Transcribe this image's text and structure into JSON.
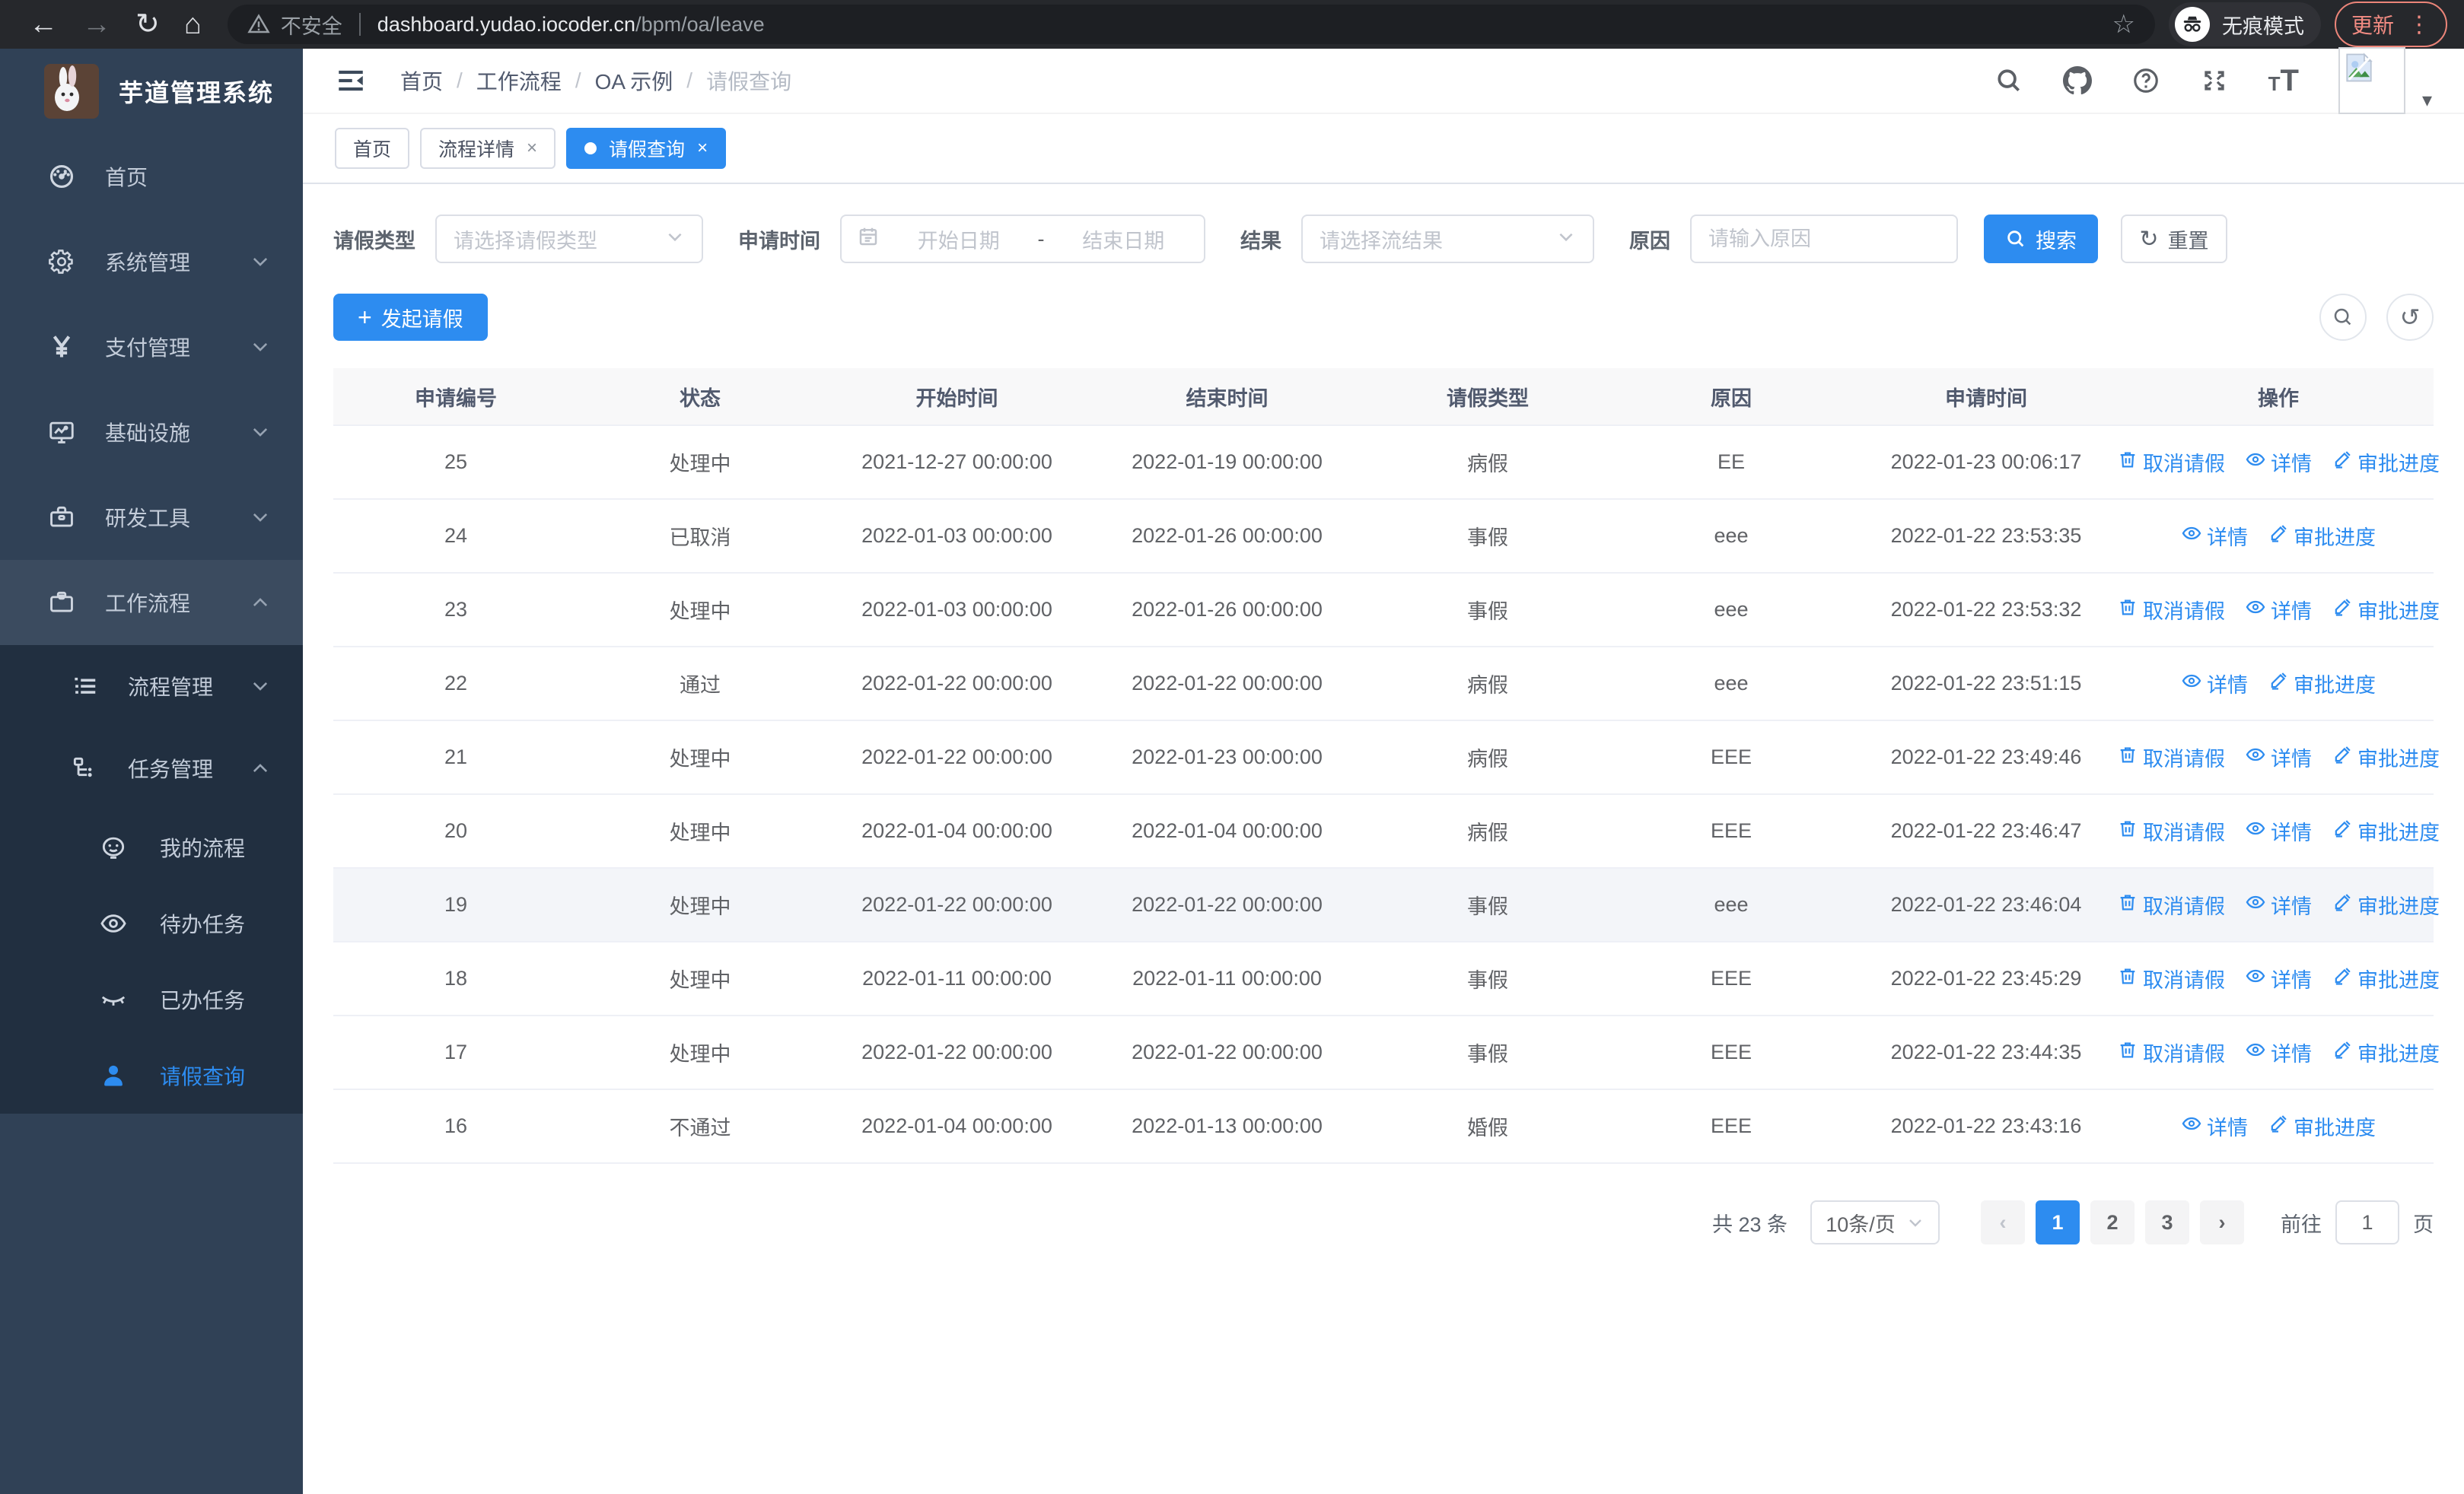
{
  "browser": {
    "security_label": "不安全",
    "url_host": "dashboard.yudao.iocoder.cn",
    "url_path": "/bpm/oa/leave",
    "incognito_label": "无痕模式",
    "update_label": "更新"
  },
  "colors": {
    "primary_blue": "#2d8cf0",
    "sidebar_bg": "#304156",
    "submenu_bg": "#212f40",
    "table_header_bg": "#f8f8f9",
    "highlight_row_bg": "#f3f5f9",
    "update_chip_red": "#f28b82"
  },
  "sidebar": {
    "title": "芋道管理系统",
    "items": [
      {
        "label": "首页",
        "icon": "dashboard-icon",
        "level": 1,
        "chevron": null,
        "active": false,
        "open": false
      },
      {
        "label": "系统管理",
        "icon": "gear-icon",
        "level": 1,
        "chevron": "down",
        "active": false,
        "open": false
      },
      {
        "label": "支付管理",
        "icon": "yen-icon",
        "level": 1,
        "chevron": "down",
        "active": false,
        "open": false
      },
      {
        "label": "基础设施",
        "icon": "monitor-icon",
        "level": 1,
        "chevron": "down",
        "active": false,
        "open": false
      },
      {
        "label": "研发工具",
        "icon": "toolbox-icon",
        "level": 1,
        "chevron": "down",
        "active": false,
        "open": false
      },
      {
        "label": "工作流程",
        "icon": "briefcase-icon",
        "level": 1,
        "chevron": "up",
        "active": false,
        "open": true
      },
      {
        "label": "流程管理",
        "icon": "list-icon",
        "level": 2,
        "chevron": "down",
        "active": false,
        "open": false
      },
      {
        "label": "任务管理",
        "icon": "flow-icon",
        "level": 2,
        "chevron": "up",
        "active": false,
        "open": true
      },
      {
        "label": "我的流程",
        "icon": "face-icon",
        "level": 3,
        "chevron": null,
        "active": false,
        "open": false
      },
      {
        "label": "待办任务",
        "icon": "eye-icon",
        "level": 3,
        "chevron": null,
        "active": false,
        "open": false
      },
      {
        "label": "已办任务",
        "icon": "eye-closed-icon",
        "level": 3,
        "chevron": null,
        "active": false,
        "open": false
      },
      {
        "label": "请假查询",
        "icon": "user-icon",
        "level": 3,
        "chevron": null,
        "active": true,
        "open": false
      }
    ]
  },
  "header": {
    "breadcrumb": [
      "首页",
      "工作流程",
      "OA 示例",
      "请假查询"
    ]
  },
  "tabs": [
    {
      "label": "首页",
      "closable": false,
      "active": false,
      "dot": false
    },
    {
      "label": "流程详情",
      "closable": true,
      "active": false,
      "dot": false
    },
    {
      "label": "请假查询",
      "closable": true,
      "active": true,
      "dot": true
    }
  ],
  "filters": {
    "leave_type_label": "请假类型",
    "leave_type_placeholder": "请选择请假类型",
    "apply_time_label": "申请时间",
    "start_date_placeholder": "开始日期",
    "date_separator": "-",
    "end_date_placeholder": "结束日期",
    "result_label": "结果",
    "result_placeholder": "请选择流结果",
    "reason_label": "原因",
    "reason_placeholder": "请输入原因",
    "search_button": "搜索",
    "reset_button": "重置"
  },
  "toolbar": {
    "create_button": "发起请假"
  },
  "table": {
    "columns": [
      "申请编号",
      "状态",
      "开始时间",
      "结束时间",
      "请假类型",
      "原因",
      "申请时间",
      "操作"
    ],
    "action_labels": {
      "cancel": "取消请假",
      "detail": "详情",
      "progress": "审批进度"
    },
    "rows": [
      {
        "id": "25",
        "status": "处理中",
        "start": "2021-12-27 00:00:00",
        "end": "2022-01-19 00:00:00",
        "type": "病假",
        "reason": "EE",
        "apply_time": "2022-01-23 00:06:17",
        "actions": [
          "cancel",
          "detail",
          "progress"
        ],
        "highlight": false
      },
      {
        "id": "24",
        "status": "已取消",
        "start": "2022-01-03 00:00:00",
        "end": "2022-01-26 00:00:00",
        "type": "事假",
        "reason": "eee",
        "apply_time": "2022-01-22 23:53:35",
        "actions": [
          "detail",
          "progress"
        ],
        "highlight": false
      },
      {
        "id": "23",
        "status": "处理中",
        "start": "2022-01-03 00:00:00",
        "end": "2022-01-26 00:00:00",
        "type": "事假",
        "reason": "eee",
        "apply_time": "2022-01-22 23:53:32",
        "actions": [
          "cancel",
          "detail",
          "progress"
        ],
        "highlight": false
      },
      {
        "id": "22",
        "status": "通过",
        "start": "2022-01-22 00:00:00",
        "end": "2022-01-22 00:00:00",
        "type": "病假",
        "reason": "eee",
        "apply_time": "2022-01-22 23:51:15",
        "actions": [
          "detail",
          "progress"
        ],
        "highlight": false
      },
      {
        "id": "21",
        "status": "处理中",
        "start": "2022-01-22 00:00:00",
        "end": "2022-01-23 00:00:00",
        "type": "病假",
        "reason": "EEE",
        "apply_time": "2022-01-22 23:49:46",
        "actions": [
          "cancel",
          "detail",
          "progress"
        ],
        "highlight": false
      },
      {
        "id": "20",
        "status": "处理中",
        "start": "2022-01-04 00:00:00",
        "end": "2022-01-04 00:00:00",
        "type": "病假",
        "reason": "EEE",
        "apply_time": "2022-01-22 23:46:47",
        "actions": [
          "cancel",
          "detail",
          "progress"
        ],
        "highlight": false
      },
      {
        "id": "19",
        "status": "处理中",
        "start": "2022-01-22 00:00:00",
        "end": "2022-01-22 00:00:00",
        "type": "事假",
        "reason": "eee",
        "apply_time": "2022-01-22 23:46:04",
        "actions": [
          "cancel",
          "detail",
          "progress"
        ],
        "highlight": true
      },
      {
        "id": "18",
        "status": "处理中",
        "start": "2022-01-11 00:00:00",
        "end": "2022-01-11 00:00:00",
        "type": "事假",
        "reason": "EEE",
        "apply_time": "2022-01-22 23:45:29",
        "actions": [
          "cancel",
          "detail",
          "progress"
        ],
        "highlight": false
      },
      {
        "id": "17",
        "status": "处理中",
        "start": "2022-01-22 00:00:00",
        "end": "2022-01-22 00:00:00",
        "type": "事假",
        "reason": "EEE",
        "apply_time": "2022-01-22 23:44:35",
        "actions": [
          "cancel",
          "detail",
          "progress"
        ],
        "highlight": false
      },
      {
        "id": "16",
        "status": "不通过",
        "start": "2022-01-04 00:00:00",
        "end": "2022-01-13 00:00:00",
        "type": "婚假",
        "reason": "EEE",
        "apply_time": "2022-01-22 23:43:16",
        "actions": [
          "detail",
          "progress"
        ],
        "highlight": false
      }
    ]
  },
  "pagination": {
    "total_label": "共 23 条",
    "page_size": "10条/页",
    "pages": [
      "1",
      "2",
      "3"
    ],
    "active_page": "1",
    "goto_label": "前往",
    "goto_value": "1",
    "page_suffix": "页"
  }
}
